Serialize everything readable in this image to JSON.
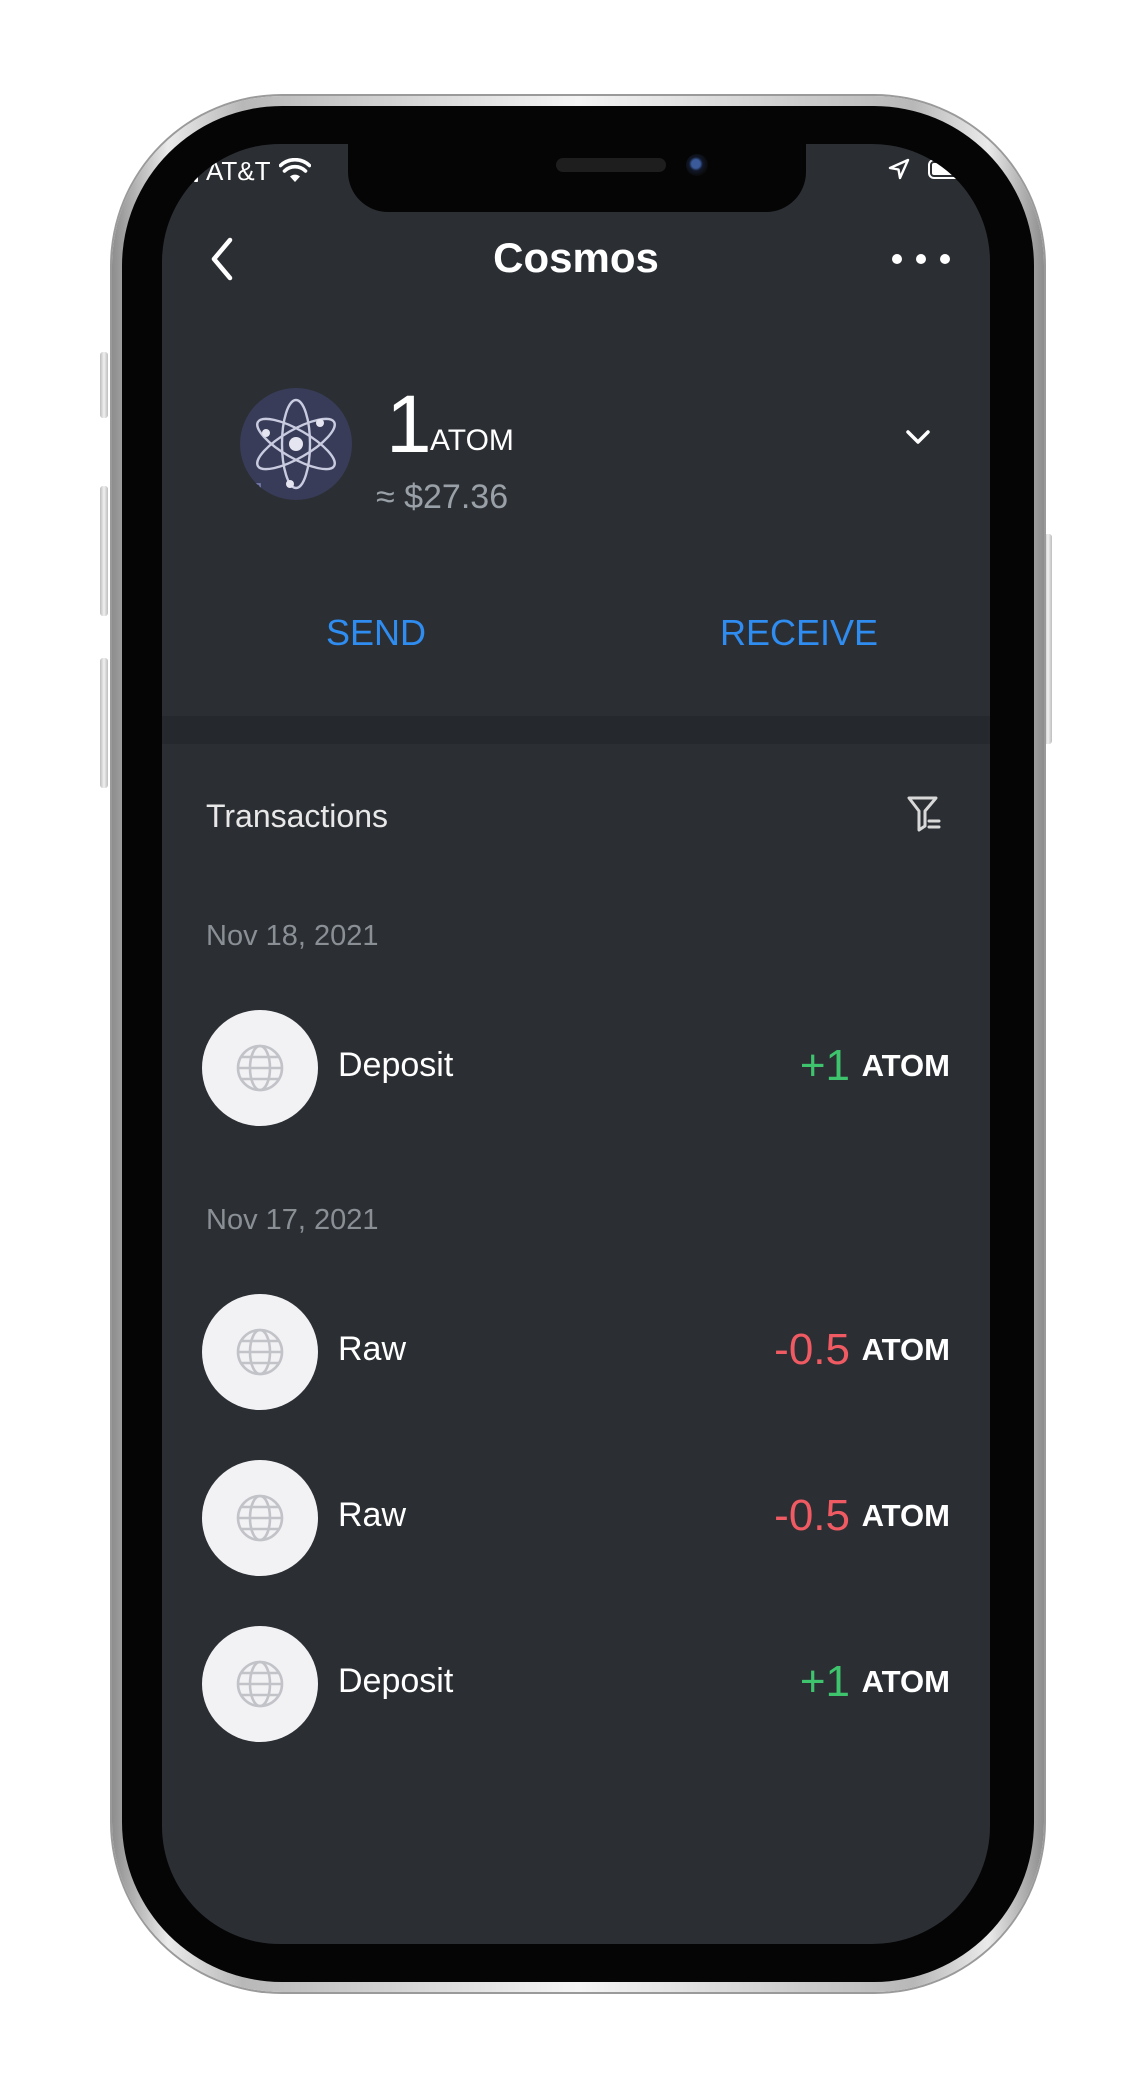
{
  "status_bar": {
    "carrier": "AT&T"
  },
  "header": {
    "title": "Cosmos"
  },
  "balance": {
    "amount": "1",
    "unit": "ATOM",
    "fiat": "≈ $27.36"
  },
  "actions": {
    "send_label": "SEND",
    "receive_label": "RECEIVE"
  },
  "transactions": {
    "title": "Transactions",
    "groups": [
      {
        "date": "Nov 18, 2021",
        "items": [
          {
            "label": "Deposit",
            "amount": "+1",
            "unit": "ATOM",
            "direction": "in"
          }
        ]
      },
      {
        "date": "Nov 17, 2021",
        "items": [
          {
            "label": "Raw",
            "amount": "-0.5",
            "unit": "ATOM",
            "direction": "out"
          },
          {
            "label": "Raw",
            "amount": "-0.5",
            "unit": "ATOM",
            "direction": "out"
          },
          {
            "label": "Deposit",
            "amount": "+1",
            "unit": "ATOM",
            "direction": "in"
          }
        ]
      }
    ]
  },
  "colors": {
    "background": "#2b2f34",
    "accent": "#2f8cf0",
    "positive": "#3ec46d",
    "negative": "#f05a62",
    "muted_text": "#8a8f96"
  },
  "icons": {
    "back": "chevron-left-icon",
    "more": "more-horizontal-icon",
    "coin": "cosmos-atom-icon",
    "expand": "chevron-down-icon",
    "filter": "filter-icon",
    "transaction": "globe-icon"
  }
}
